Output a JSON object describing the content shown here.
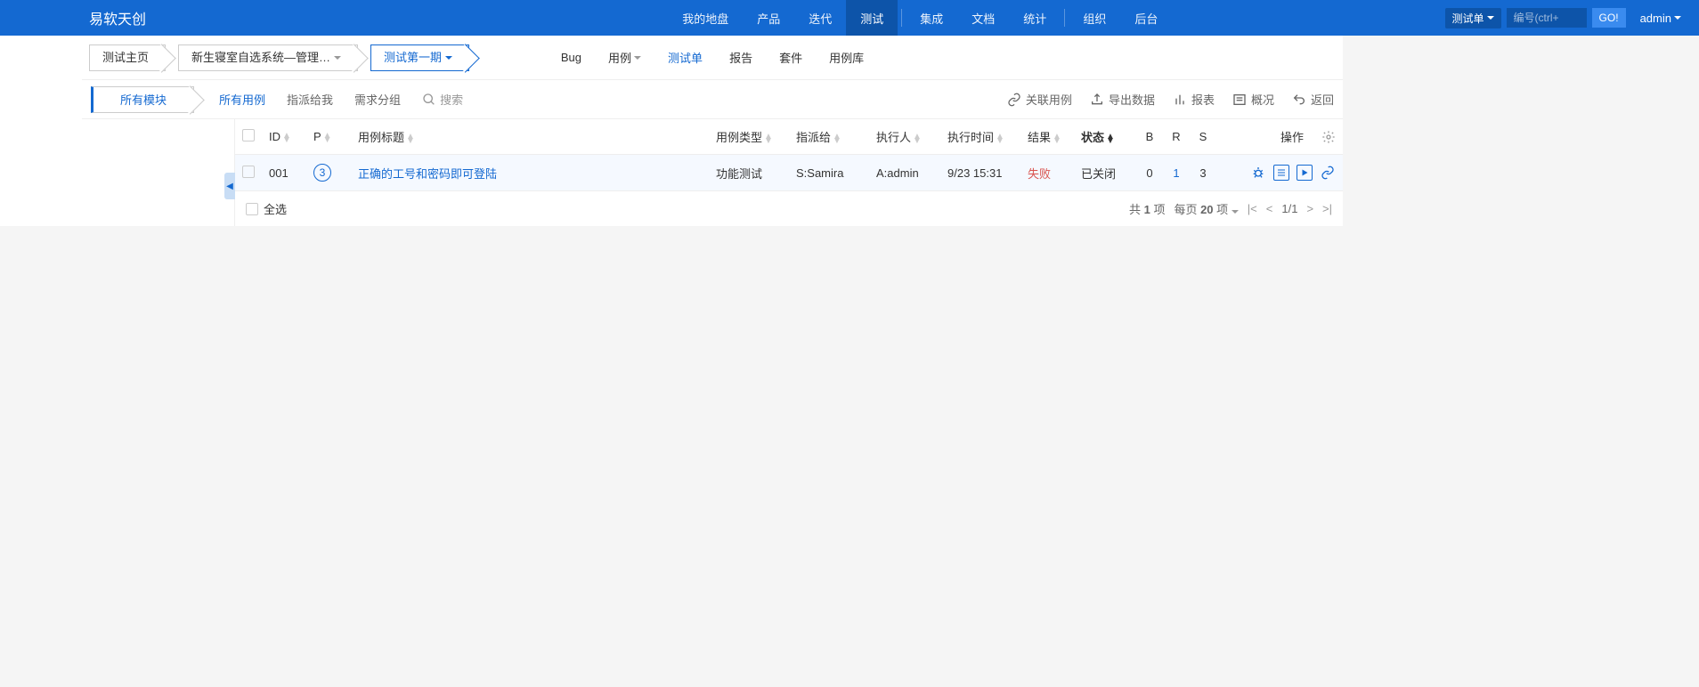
{
  "brand": "易软天创",
  "topnav": {
    "items": [
      "我的地盘",
      "产品",
      "迭代",
      "测试",
      "集成",
      "文档",
      "统计",
      "组织",
      "后台"
    ],
    "active": "测试"
  },
  "search": {
    "type_label": "测试单",
    "placeholder": "编号(ctrl+",
    "go": "GO!"
  },
  "user": "admin",
  "breadcrumb": {
    "items": [
      {
        "label": "测试主页",
        "active": false,
        "dropdown": false
      },
      {
        "label": "新生寝室自选系统—管理…",
        "active": false,
        "dropdown": true
      },
      {
        "label": "测试第一期",
        "active": true,
        "dropdown": true
      }
    ]
  },
  "subnav": {
    "items": [
      {
        "label": "Bug",
        "dropdown": false
      },
      {
        "label": "用例",
        "dropdown": true
      },
      {
        "label": "测试单",
        "dropdown": false,
        "active": true
      },
      {
        "label": "报告",
        "dropdown": false
      },
      {
        "label": "套件",
        "dropdown": false
      },
      {
        "label": "用例库",
        "dropdown": false
      }
    ]
  },
  "side_tab": "所有模块",
  "filters": {
    "items": [
      "所有用例",
      "指派给我",
      "需求分组"
    ],
    "active": "所有用例",
    "search": "搜索"
  },
  "actions": {
    "link": "关联用例",
    "export": "导出数据",
    "report": "报表",
    "overview": "概况",
    "back": "返回"
  },
  "sidebar": {
    "empty_item": ""
  },
  "table": {
    "headers": {
      "id": "ID",
      "p": "P",
      "title": "用例标题",
      "type": "用例类型",
      "assigned": "指派给",
      "executor": "执行人",
      "exec_time": "执行时间",
      "result": "结果",
      "status": "状态",
      "b": "B",
      "r": "R",
      "s": "S",
      "ops": "操作"
    },
    "rows": [
      {
        "id": "001",
        "priority": "3",
        "title": "正确的工号和密码即可登陆",
        "type": "功能测试",
        "assigned": "S:Samira",
        "executor": "A:admin",
        "exec_time": "9/23 15:31",
        "result": "失败",
        "status": "已关闭",
        "b": "0",
        "r": "1",
        "s": "3"
      }
    ]
  },
  "footer": {
    "select_all": "全选",
    "total_prefix": "共 ",
    "total_num": "1",
    "total_suffix": " 项",
    "perpage_prefix": "每页 ",
    "perpage_num": "20",
    "perpage_suffix": " 项",
    "page": "1/1"
  }
}
